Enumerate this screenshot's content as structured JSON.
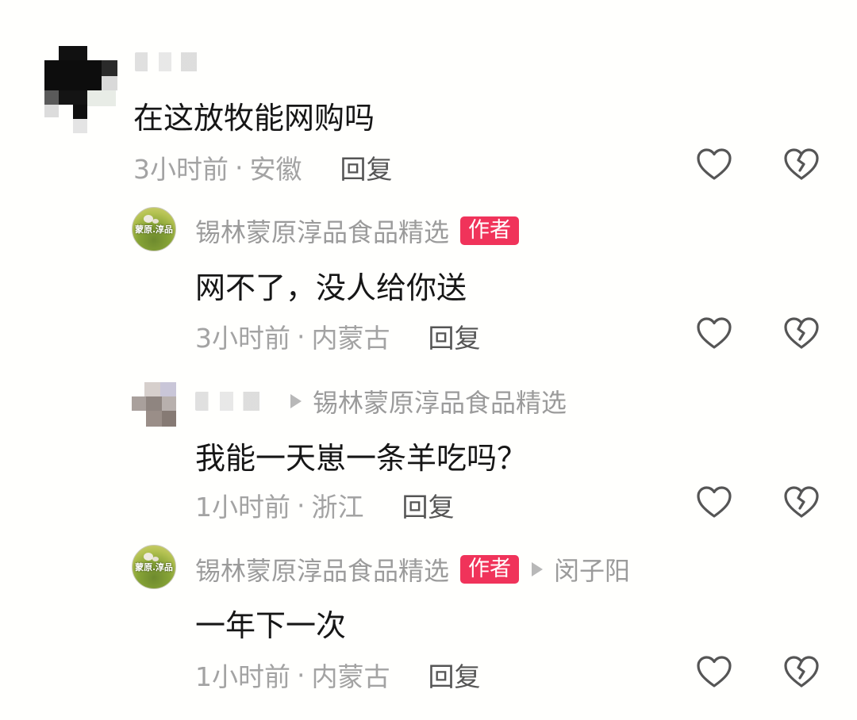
{
  "comments": [
    {
      "user": {
        "name": ""
      },
      "content": "在这放牧能网购吗",
      "time": "3小时前",
      "separator": "·",
      "location": "安徽",
      "reply_label": "回复",
      "like_icon": "heart-outline",
      "dislike_icon": "broken-heart-outline"
    },
    {
      "user": {
        "name": "锡林蒙原淳品食品精选",
        "avatar_text": "蒙原.淳品"
      },
      "badge": "作者",
      "content": "网不了，没人给你送",
      "time": "3小时前",
      "separator": "·",
      "location": "内蒙古",
      "reply_label": "回复",
      "like_icon": "heart-outline",
      "dislike_icon": "broken-heart-outline"
    },
    {
      "user": {
        "name": ""
      },
      "reply_to": "锡林蒙原淳品食品精选",
      "content": "我能一天崽一条羊吃吗？",
      "time": "1小时前",
      "separator": "·",
      "location": "浙江",
      "reply_label": "回复",
      "like_icon": "heart-outline",
      "dislike_icon": "broken-heart-outline"
    },
    {
      "user": {
        "name": "锡林蒙原淳品食品精选",
        "avatar_text": "蒙原.淳品"
      },
      "badge": "作者",
      "reply_to": "闵子阳",
      "content": "一年下一次",
      "time": "1小时前",
      "separator": "·",
      "location": "内蒙古",
      "reply_label": "回复",
      "like_icon": "heart-outline",
      "dislike_icon": "broken-heart-outline"
    }
  ],
  "colors": {
    "author_badge": "#f0335a",
    "meta_text": "#a3a3a3",
    "name_text": "#9b9b9b",
    "content_text": "#161616",
    "icon_stroke": "#555555"
  }
}
